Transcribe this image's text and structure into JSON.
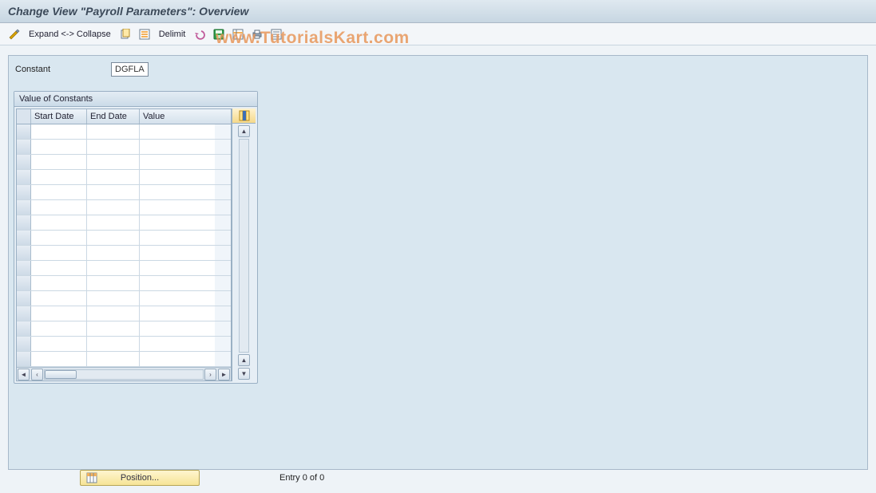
{
  "title": "Change View \"Payroll Parameters\": Overview",
  "watermark": "www.TutorialsKart.com",
  "toolbar": {
    "expand_collapse_label": "Expand <-> Collapse",
    "delimit_label": "Delimit"
  },
  "field": {
    "label": "Constant",
    "value": "DGFLA"
  },
  "groupbox": {
    "title": "Value of Constants",
    "columns": {
      "c1": "Start Date",
      "c2": "End Date",
      "c3": "Value"
    },
    "rows": [
      {
        "start": "",
        "end": "",
        "value": ""
      },
      {
        "start": "",
        "end": "",
        "value": ""
      },
      {
        "start": "",
        "end": "",
        "value": ""
      },
      {
        "start": "",
        "end": "",
        "value": ""
      },
      {
        "start": "",
        "end": "",
        "value": ""
      },
      {
        "start": "",
        "end": "",
        "value": ""
      },
      {
        "start": "",
        "end": "",
        "value": ""
      },
      {
        "start": "",
        "end": "",
        "value": ""
      },
      {
        "start": "",
        "end": "",
        "value": ""
      },
      {
        "start": "",
        "end": "",
        "value": ""
      },
      {
        "start": "",
        "end": "",
        "value": ""
      },
      {
        "start": "",
        "end": "",
        "value": ""
      },
      {
        "start": "",
        "end": "",
        "value": ""
      },
      {
        "start": "",
        "end": "",
        "value": ""
      },
      {
        "start": "",
        "end": "",
        "value": ""
      },
      {
        "start": "",
        "end": "",
        "value": ""
      }
    ]
  },
  "footer": {
    "position_label": "Position...",
    "entry_text": "Entry 0 of 0"
  }
}
